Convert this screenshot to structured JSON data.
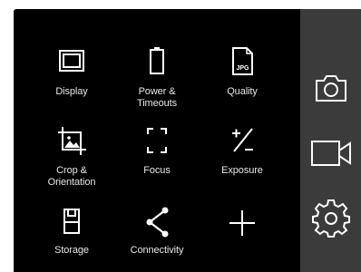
{
  "menu": {
    "items": [
      {
        "id": "display",
        "label": "Display",
        "icon": "display-icon"
      },
      {
        "id": "power",
        "label": "Power &\nTimeouts",
        "icon": "battery-icon"
      },
      {
        "id": "quality",
        "label": "Quality",
        "icon": "jpg-file-icon",
        "icon_text": "JPG"
      },
      {
        "id": "crop",
        "label": "Crop &\nOrientation",
        "icon": "crop-image-icon"
      },
      {
        "id": "focus",
        "label": "Focus",
        "icon": "focus-brackets-icon"
      },
      {
        "id": "exposure",
        "label": "Exposure",
        "icon": "plus-minus-icon"
      },
      {
        "id": "storage",
        "label": "Storage",
        "icon": "sd-card-icon"
      },
      {
        "id": "connectivity",
        "label": "Connectivity",
        "icon": "share-icon"
      },
      {
        "id": "add",
        "label": "",
        "icon": "plus-icon"
      }
    ]
  },
  "sidebar": {
    "buttons": [
      {
        "id": "photo",
        "icon": "camera-icon"
      },
      {
        "id": "video",
        "icon": "video-camera-icon"
      },
      {
        "id": "settings",
        "icon": "gear-icon"
      }
    ]
  },
  "colors": {
    "background": "#000000",
    "sidebar": "#3b3b3b",
    "icon": "#ffffff",
    "label": "#e6e6e6"
  }
}
